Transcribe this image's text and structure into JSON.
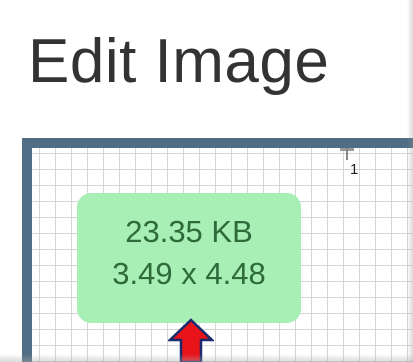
{
  "header": {
    "title": "Edit Image"
  },
  "canvas": {
    "ruler_label": "1",
    "info_badge": {
      "file_size": "23.35 KB",
      "dimensions": "3.49 x 4.48"
    }
  },
  "colors": {
    "frame": "#4f6d84",
    "badge_background": "#a8efb5",
    "badge_text": "#2e6a3a",
    "arrow_fill": "#e8141a",
    "arrow_stroke": "#1a2a6c"
  },
  "icons": {
    "annotation": "up-arrow-icon"
  }
}
